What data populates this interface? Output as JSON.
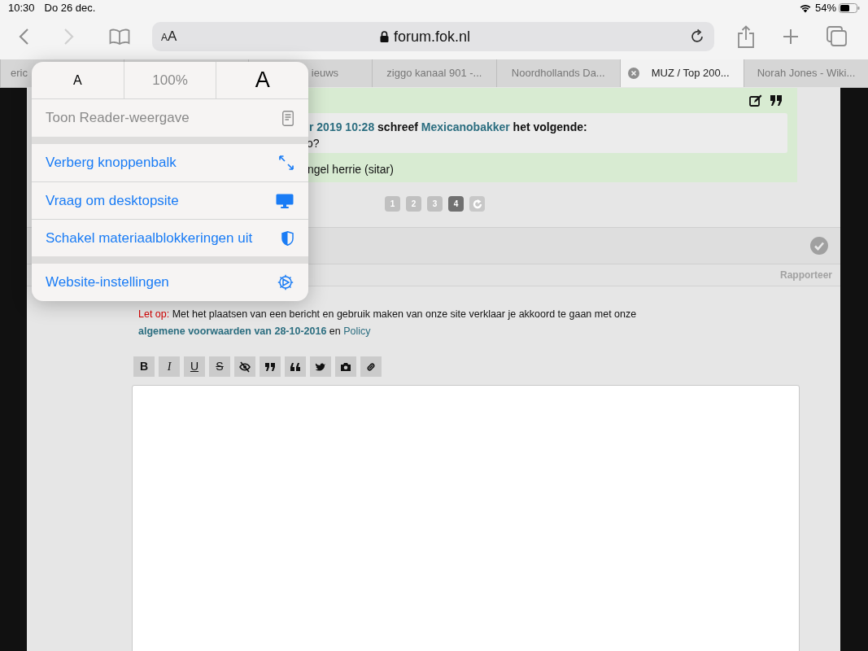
{
  "status_bar": {
    "time": "10:30",
    "date": "Do 26 dec.",
    "battery": "54%"
  },
  "toolbar": {
    "back_disabled": false,
    "forward_disabled": true,
    "text_size_button": "AA",
    "address": "forum.fok.nl"
  },
  "tabs": [
    {
      "label": "eric",
      "kind": "covered",
      "selected": false
    },
    {
      "kind": "hidden",
      "selected": false
    },
    {
      "label": "ieuws",
      "kind": "covered",
      "selected": false
    },
    {
      "label": "ziggo kanaal 901 -...",
      "kind": "normal",
      "selected": false
    },
    {
      "label": "Noordhollands Da...",
      "kind": "normal",
      "selected": false
    },
    {
      "label": "MUZ / Top 200...",
      "kind": "normal",
      "selected": true
    },
    {
      "label": "Norah Jones - Wiki...",
      "kind": "normal",
      "selected": false
    }
  ],
  "popover": {
    "font_row": {
      "smaller": "A",
      "zoom": "100%",
      "larger": "A"
    },
    "groups": [
      [
        {
          "label": "Toon Reader-weergave",
          "disabled": true,
          "kind": "reader"
        }
      ],
      [
        {
          "label": "Verberg knoppenbalk",
          "disabled": false,
          "kind": "hide"
        },
        {
          "label": "Vraag om desktopsite",
          "disabled": false,
          "kind": "desktop"
        },
        {
          "label": "Schakel materiaalblokkeringen uit",
          "disabled": false,
          "kind": "shield"
        }
      ],
      [
        {
          "label": "Website-instellingen",
          "disabled": false,
          "kind": "settings"
        }
      ]
    ]
  },
  "post": {
    "quote_date": "r 2019 10:28",
    "quote_verb": "schreef",
    "quote_author": "Mexicanobakker",
    "quote_suffix": "het volgende:",
    "quote_text": "o?",
    "reply_text": "ngel herrie (sitar)"
  },
  "pagination": [
    {
      "label": "1",
      "selected": false
    },
    {
      "label": "2",
      "selected": false
    },
    {
      "label": "3",
      "selected": false
    },
    {
      "label": "4",
      "selected": true
    }
  ],
  "report_link": "Rapporteer",
  "notice": {
    "warning": "Let op:",
    "text": "Met het plaatsen van een bericht en gebruik maken van onze site verklaar je akkoord te gaan met onze",
    "terms_link": "algemene voorwaarden van 28-10-2016",
    "joiner": "en",
    "policy_link": "Policy"
  },
  "editor": {
    "format_buttons": [
      "B",
      "I",
      "U",
      "S"
    ]
  }
}
